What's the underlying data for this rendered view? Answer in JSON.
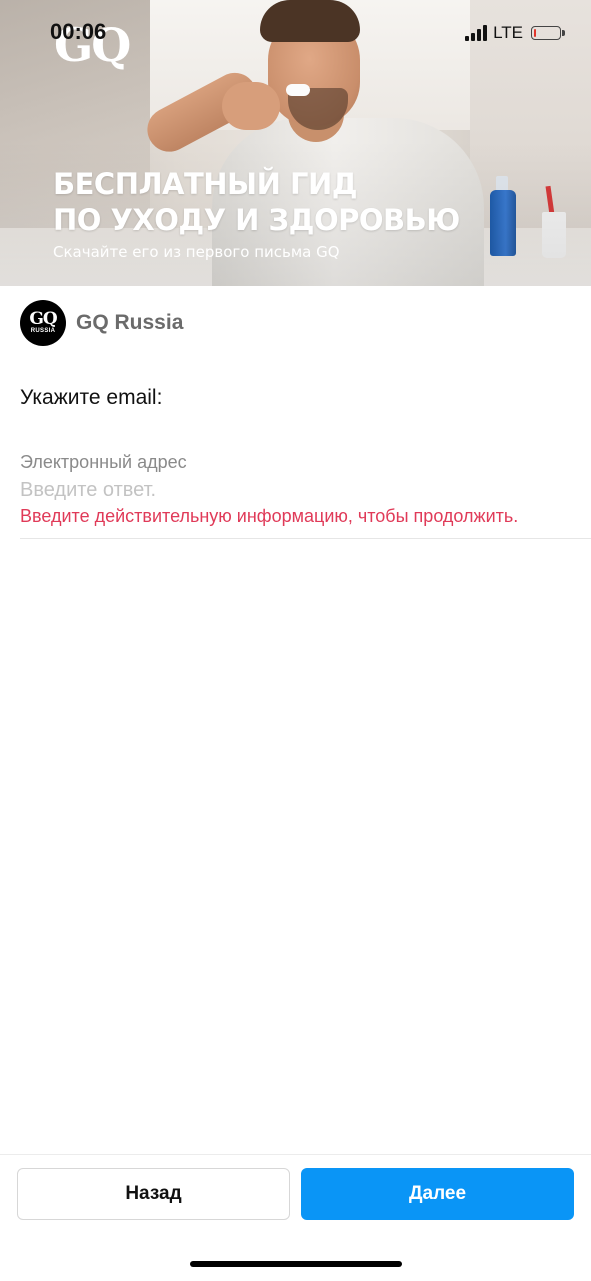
{
  "status_bar": {
    "time": "00:06",
    "network": "LTE",
    "battery_level": 0.05
  },
  "banner": {
    "brand": "GQ",
    "title_line1": "БЕСПЛАТНЫЙ ГИД",
    "title_line2": "ПО УХОДУ И ЗДОРОВЬЮ",
    "subtitle": "Скачайте его из первого письма GQ"
  },
  "account": {
    "avatar_mark": "GQ",
    "avatar_sub": "RUSSIA",
    "name": "GQ Russia"
  },
  "form": {
    "question": "Укажите email:",
    "field_label": "Электронный адрес",
    "field_value": "",
    "field_placeholder": "Введите ответ.",
    "error": "Введите действительную информацию, чтобы продолжить."
  },
  "actions": {
    "back_label": "Назад",
    "next_label": "Далее"
  },
  "colors": {
    "accent": "#0a95f6",
    "error": "#e03a58",
    "battery_low": "#e0352b"
  },
  "icons": {
    "signal": "signal-bars-icon",
    "battery": "battery-icon"
  }
}
